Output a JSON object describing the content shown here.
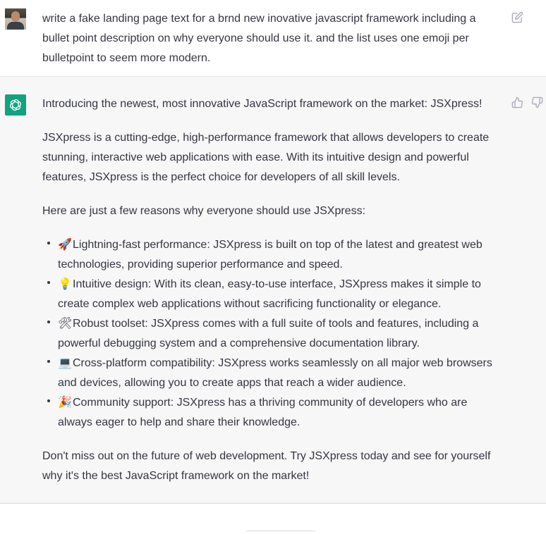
{
  "user_message": {
    "text": "write a fake landing page text for a brnd new inovative javascript framework including a bullet point description on why everyone should use it. and the list uses one emoji per bulletpoint to seem more modern."
  },
  "assistant_message": {
    "intro": "Introducing the newest, most innovative JavaScript framework on the market: JSXpress!",
    "description": "JSXpress is a cutting-edge, high-performance framework that allows developers to create stunning, interactive web applications with ease. With its intuitive design and powerful features, JSXpress is the perfect choice for developers of all skill levels.",
    "reasons_intro": "Here are just a few reasons why everyone should use JSXpress:",
    "bullets": [
      {
        "emoji": "🚀",
        "text": "Lightning-fast performance: JSXpress is built on top of the latest and greatest web technologies, providing superior performance and speed."
      },
      {
        "emoji": "💡",
        "text": "Intuitive design: With its clean, easy-to-use interface, JSXpress makes it simple to create complex web applications without sacrificing functionality or elegance."
      },
      {
        "emoji": "🛠",
        "text": "Robust toolset: JSXpress comes with a full suite of tools and features, including a powerful debugging system and a comprehensive documentation library."
      },
      {
        "emoji": "💻",
        "text": "Cross-platform compatibility: JSXpress works seamlessly on all major web browsers and devices, allowing you to create apps that reach a wider audience."
      },
      {
        "emoji": "🎉",
        "text": "Community support: JSXpress has a thriving community of developers who are always eager to help and share their knowledge."
      }
    ],
    "closing": "Don't miss out on the future of web development. Try JSXpress today and see for yourself why it's the best JavaScript framework on the market!"
  },
  "icons": {
    "user_avatar": "user-avatar-photo",
    "assistant_avatar": "openai-logo-icon",
    "edit": "edit-icon",
    "thumbs_up": "thumbs-up-icon",
    "thumbs_down": "thumbs-down-icon"
  },
  "colors": {
    "assistant_bg": "#f7f7f8",
    "brand": "#10a37f",
    "text": "#343541",
    "icon": "#acacbe"
  }
}
